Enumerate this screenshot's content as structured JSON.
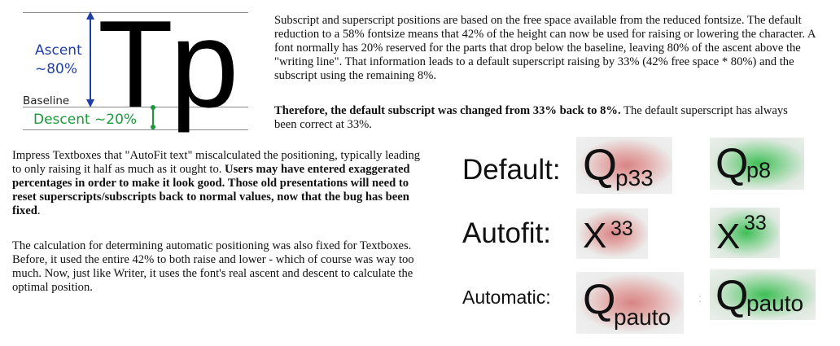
{
  "diagram": {
    "glyphs": "Tp",
    "ascent_label": "Ascent",
    "ascent_value": "~80%",
    "baseline_label": "Baseline",
    "descent_label": "Descent ~20%",
    "colors": {
      "ascent": "#1f3fa8",
      "descent": "#1a9a3a",
      "lines": "#8a8a8a"
    }
  },
  "top_paragraph": {
    "text": "Subscript and superscript positions are based on the free space available from the reduced fontsize. The default reduction to a 58% fontsize means that 42% of the height can now be used for raising or lowering the character. A font normally has 20% reserved for the parts that drop below the baseline, leaving 80% of the ascent above the \"writing line\". That information leads to a default superscript raising by 33% (42% free space * 80%) and the subscript using the remaining 8%."
  },
  "bold_paragraph": {
    "bold": "Therefore, the default subscript was changed from 33% back to 8%.",
    "rest": " The default superscript has always been correct at 33%."
  },
  "left_paragraph_1": {
    "start": "Impress Textboxes that \"AutoFit text\" miscalculated the positioning, typically leading to only raising it half as much as it ought to. ",
    "bold": "Users may have entered exaggerated percentages in order to make it look good. Those old presentations will need to reset superscripts/subscripts back to normal values, now that the bug has been fixed",
    "end": "."
  },
  "left_paragraph_2": {
    "text": "The calculation for determining automatic positioning was also fixed for Textboxes. Before, it used the entire 42% to both raise and lower - which of course was way too much. Now, just like Writer, it uses the font's real ascent and descent to calculate the optimal position."
  },
  "examples": {
    "labels": {
      "default": "Default:",
      "autofit": "Autofit:",
      "automatic": "Automatic:"
    },
    "default_before": {
      "base": "Q",
      "script": "p33"
    },
    "default_after": {
      "base": "Q",
      "script": "p8"
    },
    "autofit_before": {
      "base": "X",
      "script": "33"
    },
    "autofit_after": {
      "base": "X",
      "script": "33"
    },
    "automatic_before": {
      "base": "Q",
      "script": "pauto"
    },
    "automatic_after": {
      "base": "Q",
      "script": "pauto"
    },
    "separator": ":",
    "colors": {
      "before": "#d88585",
      "after": "#3fbf57"
    }
  }
}
